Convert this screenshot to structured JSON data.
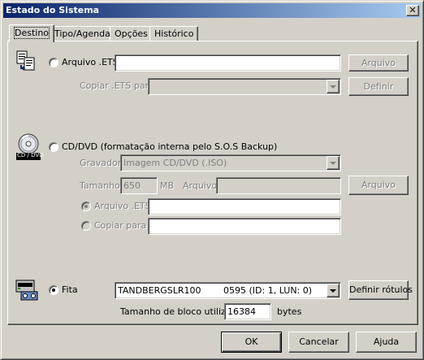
{
  "window": {
    "title": "Estado do Sistema",
    "close_glyph": "✕"
  },
  "tabs": [
    {
      "label": "Destino",
      "active": true
    },
    {
      "label": "Tipo/Agenda",
      "active": false
    },
    {
      "label": "Opções",
      "active": false
    },
    {
      "label": "Histórico",
      "active": false
    }
  ],
  "arquivo": {
    "radio_label": "Arquivo .ETS",
    "radio_selected": false,
    "path_value": "",
    "browse_button": "Arquivo",
    "copy_label": "Copiar .ETS para",
    "copy_value": "",
    "define_button": "Definir",
    "icon": "copy-files-icon"
  },
  "cddvd": {
    "radio_label": "CD/DVD (formatação interna pelo S.O.S Backup)",
    "radio_selected": false,
    "icon": "cd-dvd-icon",
    "icon_caption": "CD / DVD",
    "writer_label": "Gravador",
    "writer_value": "Imagem CD/DVD (.ISO)",
    "size_label": "Tamanho",
    "size_value": "650",
    "size_unit": "MB",
    "file_label": "Arquivo",
    "file_value": "",
    "file_button": "Arquivo",
    "ets_radio_label": "Arquivo .ETS",
    "ets_value": "",
    "copy_radio_label": "Copiar para",
    "copy_value": ""
  },
  "fita": {
    "radio_label": "Fita",
    "radio_selected": true,
    "icon": "tape-drive-icon",
    "device_name": "TANDBERGSLR100",
    "device_detail": "0595 (ID: 1, LUN: 0)",
    "labels_button": "Definir rótulos",
    "block_label": "Tamanho de bloco utilizado",
    "block_value": "16384",
    "block_unit": "bytes"
  },
  "footer": {
    "ok": "OK",
    "cancel": "Cancelar",
    "help": "Ajuda"
  }
}
